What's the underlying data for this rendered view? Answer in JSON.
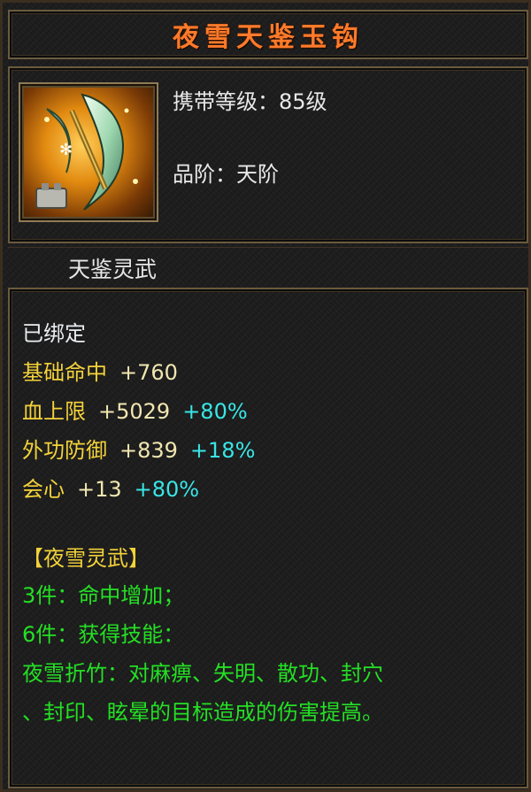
{
  "item": {
    "name": "夜雪天鉴玉钩",
    "carry_level": "携带等级：85级",
    "grade": "品阶：天阶",
    "type": "天鉴灵武"
  },
  "binding": "已绑定",
  "stats": [
    {
      "label": "基础命中",
      "value": "+760",
      "percent": ""
    },
    {
      "label": "血上限",
      "value": "+5029",
      "percent": "+80%"
    },
    {
      "label": "外功防御",
      "value": "+839",
      "percent": "+18%"
    },
    {
      "label": "会心",
      "value": "+13",
      "percent": "+80%"
    }
  ],
  "set": {
    "name": "【夜雪灵武】",
    "bonus_3": "3件：命中增加；",
    "bonus_6": "6件：获得技能：",
    "skill_line1": "夜雪折竹：对麻痹、失明、散功、封穴",
    "skill_line2": "、封印、眩晕的目标造成的伤害提高。"
  },
  "colors": {
    "title": "#ff7a2a",
    "stat_label": "#f3d23a",
    "percent": "#39e6e6",
    "set_text": "#24e024"
  },
  "icon": "jade-hook-weapon-icon"
}
